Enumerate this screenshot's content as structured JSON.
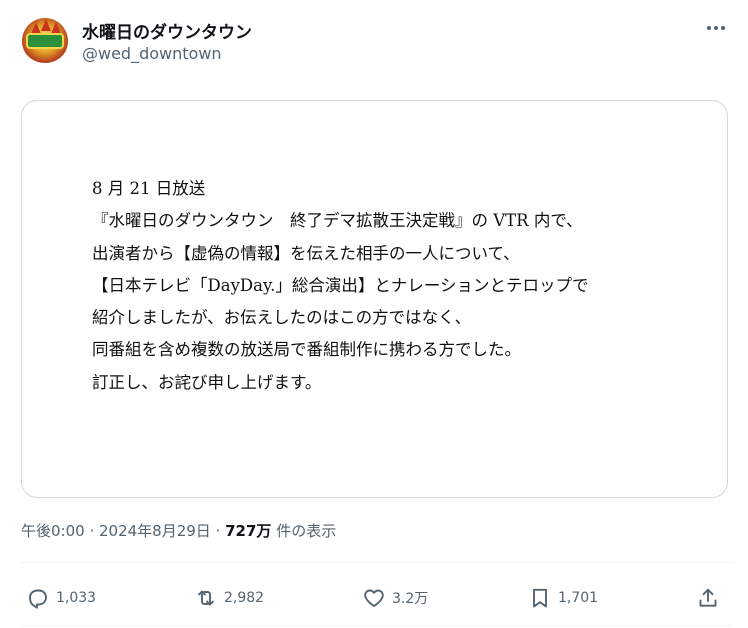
{
  "account": {
    "display_name": "水曜日のダウンタウン",
    "handle": "@wed_downtown",
    "avatar_icon": "show-logo-avatar"
  },
  "more_icon": "more-dots-icon",
  "media": {
    "lines": [
      "8 月 21 日放送",
      "『水曜日のダウンタウン　終了デマ拡散王決定戦』の VTR 内で、",
      "出演者から【虚偽の情報】を伝えた相手の一人について、",
      "【日本テレビ「DayDay.」総合演出】とナレーションとテロップで",
      "紹介しましたが、お伝えしたのはこの方ではなく、",
      "同番組を含め複数の放送局で番組制作に携わる方でした。",
      "訂正し、お詫び申し上げます。"
    ]
  },
  "meta": {
    "time": "午後0:00",
    "sep1": " · ",
    "date": "2024年8月29日",
    "sep2": " · ",
    "views_count": "727万",
    "views_label": " 件の表示"
  },
  "actions": {
    "reply": {
      "icon": "reply-icon",
      "count": "1,033"
    },
    "retweet": {
      "icon": "retweet-icon",
      "count": "2,982"
    },
    "like": {
      "icon": "heart-icon",
      "count": "3.2万"
    },
    "bookmark": {
      "icon": "bookmark-icon",
      "count": "1,701"
    },
    "share": {
      "icon": "share-icon"
    }
  },
  "colors": {
    "text_primary": "#0f1419",
    "text_secondary": "#536471",
    "border": "#cfd9de"
  }
}
